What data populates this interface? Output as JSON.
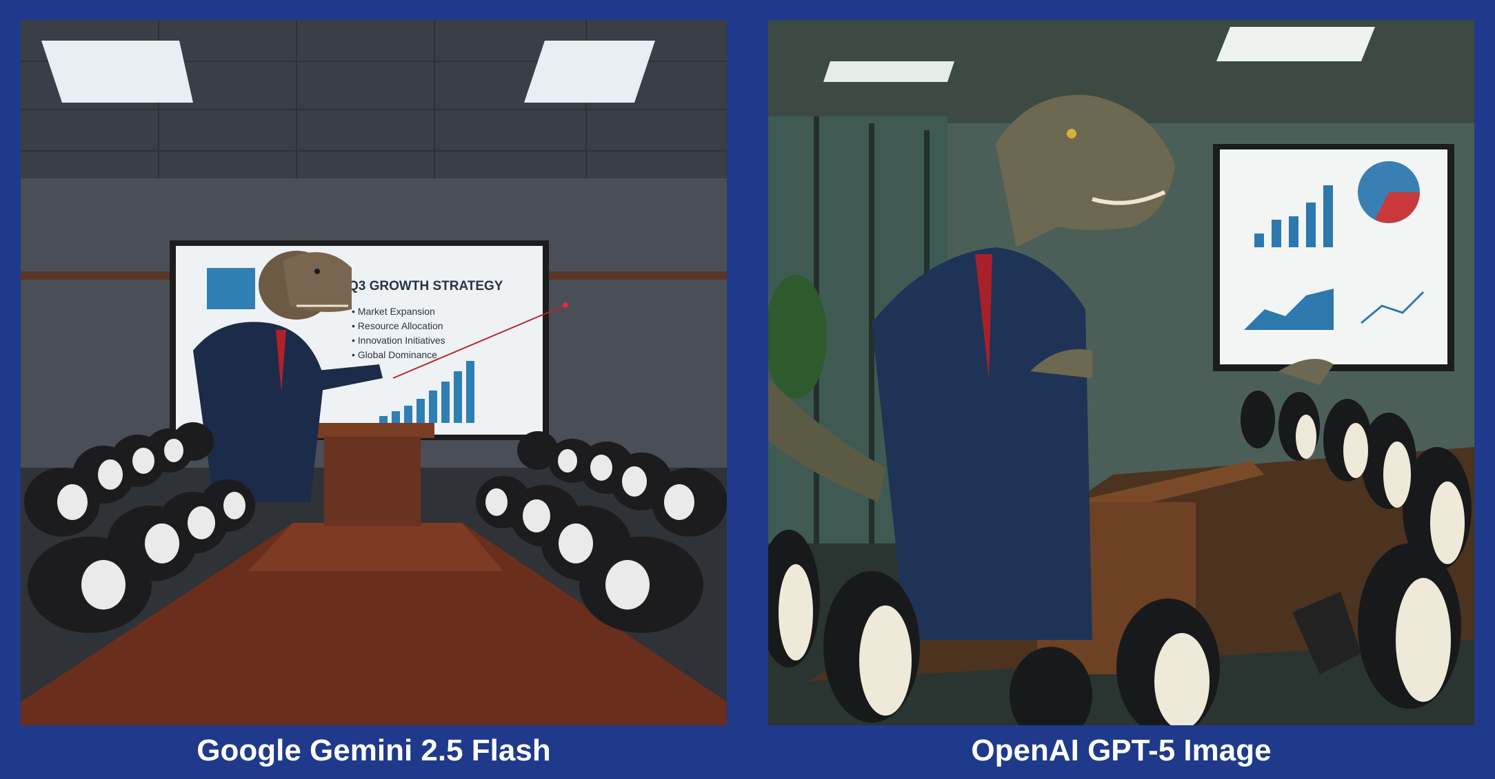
{
  "captions": {
    "left": "Google Gemini 2.5 Flash",
    "right": "OpenAI GPT-5 Image"
  },
  "left_slide": {
    "title": "Q3 GROWTH STRATEGY",
    "bullets": [
      "• Market Expansion",
      "• Resource Allocation",
      "• Innovation Initiatives",
      "• Global Dominance"
    ]
  },
  "colors": {
    "background": "#1f3a8a",
    "caption_text": "#ffffff"
  }
}
